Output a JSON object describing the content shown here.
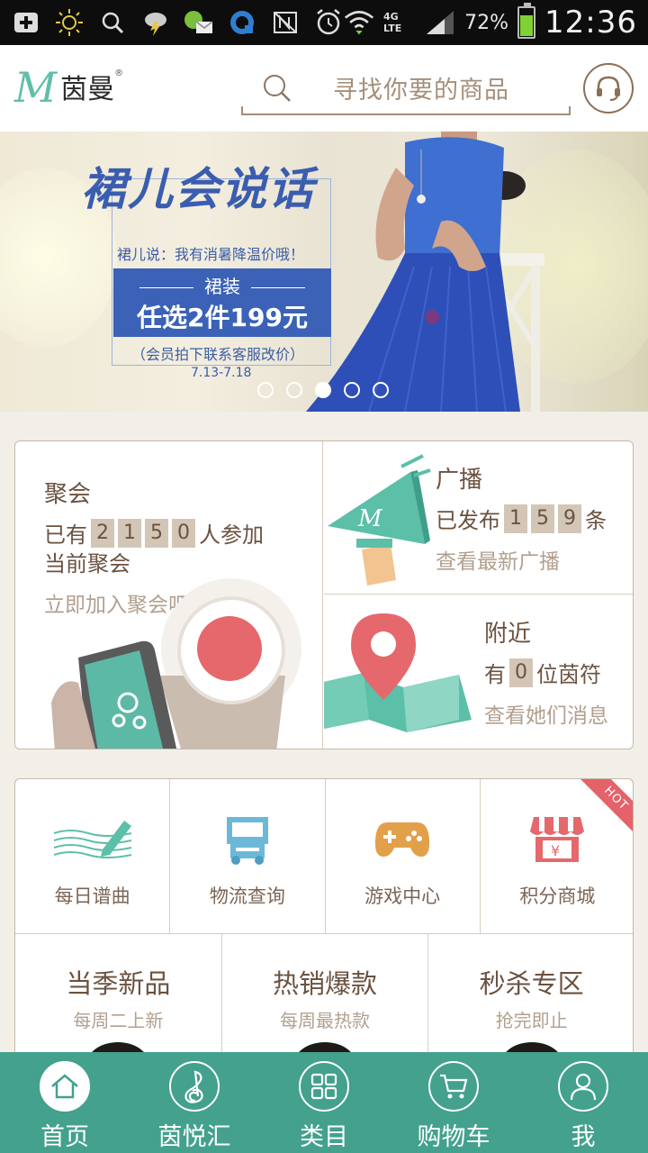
{
  "status_bar": {
    "network": "4G LTE",
    "battery": "72%",
    "battery_level": 0.72,
    "time": "12:36"
  },
  "header": {
    "logo_text": "茵曼",
    "logo_mark": "M",
    "logo_registered": "®",
    "search_placeholder": "寻找你要的商品"
  },
  "banner": {
    "title": "裙儿会说话",
    "subtitle": "裙儿说：我有消暑降温价哦！",
    "box_top": "裙装",
    "box_main": "任选2件199元",
    "note": "（会员拍下联系客服改价）",
    "date": "7.13-7.18",
    "active_slide": 3,
    "slide_count": 5
  },
  "gathering": {
    "title": "聚会",
    "prefix": "已有",
    "digits": [
      "2",
      "1",
      "5",
      "0"
    ],
    "suffix": "人参加",
    "line2": "当前聚会",
    "link": "立即加入聚会吧"
  },
  "broadcast": {
    "title": "广播",
    "prefix": "已发布",
    "digits": [
      "1",
      "5",
      "9"
    ],
    "suffix": "条",
    "link": "查看最新广播"
  },
  "nearby": {
    "title": "附近",
    "prefix": "有",
    "digits": [
      "0"
    ],
    "suffix": "位茵符",
    "link": "查看她们消息"
  },
  "services": [
    {
      "label": "每日谱曲",
      "icon": "music-score-icon"
    },
    {
      "label": "物流查询",
      "icon": "truck-icon"
    },
    {
      "label": "游戏中心",
      "icon": "gamepad-icon"
    },
    {
      "label": "积分商城",
      "icon": "store-icon"
    }
  ],
  "hot_badge": "HOT",
  "promos": [
    {
      "title": "当季新品",
      "sub": "每周二上新"
    },
    {
      "title": "热销爆款",
      "sub": "每周最热款"
    },
    {
      "title": "秒杀专区",
      "sub": "抢完即止"
    }
  ],
  "bottom_nav": [
    {
      "label": "首页",
      "icon": "home-icon",
      "active": true
    },
    {
      "label": "茵悦汇",
      "icon": "treble-clef-icon",
      "active": false
    },
    {
      "label": "类目",
      "icon": "grid-icon",
      "active": false
    },
    {
      "label": "购物车",
      "icon": "cart-icon",
      "active": false
    },
    {
      "label": "我",
      "icon": "user-icon",
      "active": false
    }
  ],
  "colors": {
    "brand_teal": "#43a18e",
    "accent_red": "#e4626a",
    "text_brown": "#6b5240",
    "banner_blue": "#3b62b7"
  }
}
